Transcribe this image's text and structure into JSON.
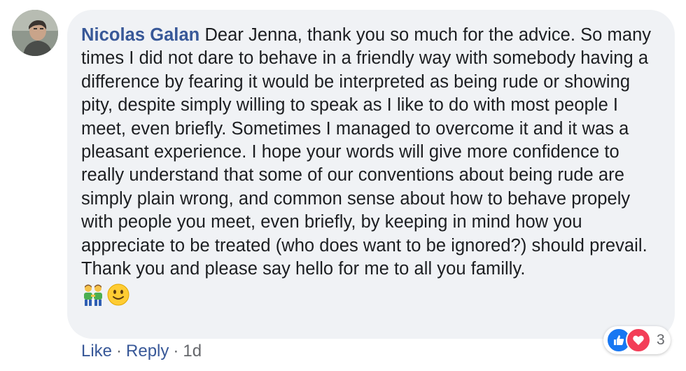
{
  "comment": {
    "author": "Nicolas Galan",
    "text": " Dear Jenna, thank you so much for the advice. So many times I did not dare to behave in a friendly way with somebody having a difference by fearing it would be interpreted as being rude or showing pity, despite simply willing to speak as I like to do with most people I meet, even briefly. Sometimes I managed to overcome it and it was a pleasant experience. I hope your words will give more confidence to really understand that some of our conventions about being rude are simply plain wrong, and common sense about how to behave propely with people you meet, even briefly, by keeping in mind how you appreciate to be treated (who does want to be ignored?) should prevail. Thank you and please say hello for me to all you familly.",
    "emojis": [
      "people-holding-hands-emoji",
      "slightly-smiling-face-emoji"
    ]
  },
  "actions": {
    "like_label": "Like",
    "separator": "·",
    "reply_label": "Reply",
    "timestamp": "1d"
  },
  "reactions": {
    "icons": [
      "like-icon",
      "love-icon"
    ],
    "count": "3"
  },
  "colors": {
    "bubble_bg": "#f0f2f5",
    "author_link": "#385898",
    "body_text": "#1c1e21",
    "meta_text": "#65676b",
    "like_blue": "#1877f2",
    "love_red": "#f33e58"
  }
}
